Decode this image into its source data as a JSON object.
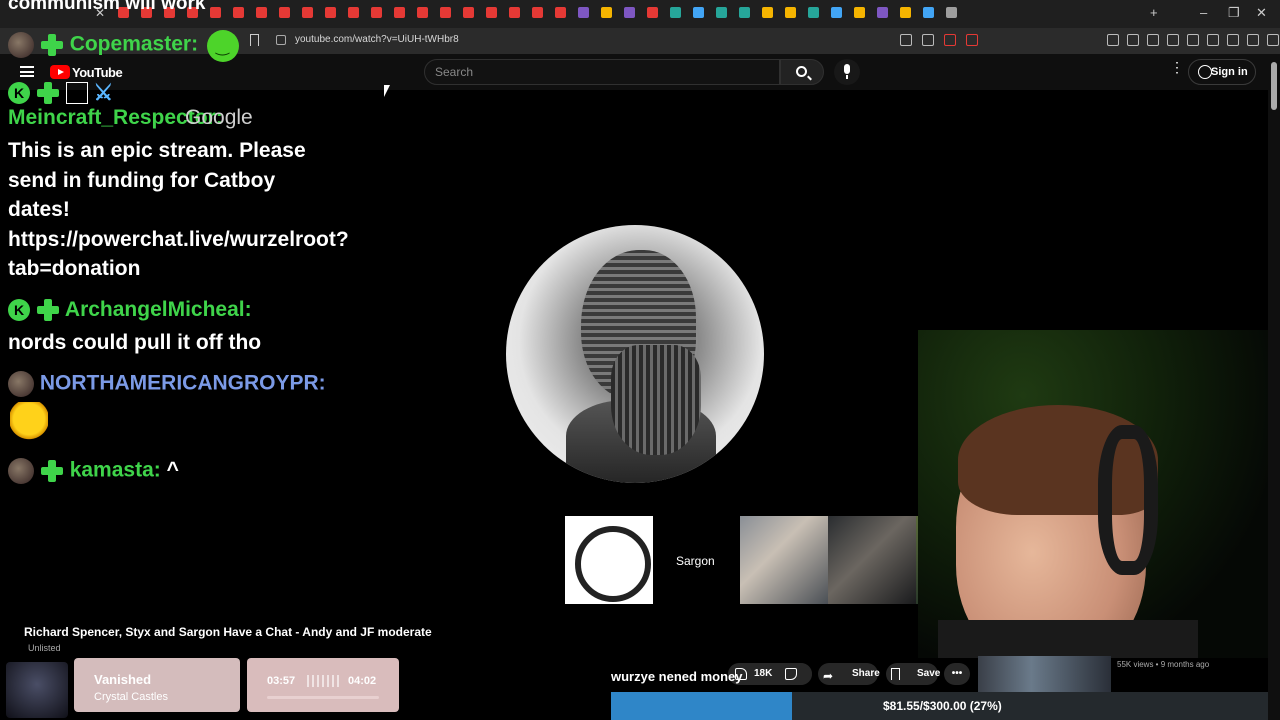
{
  "stream_title": "communism will work",
  "browser": {
    "url": "youtube.com/watch?v=UiUH-tWHbr8"
  },
  "youtube": {
    "logo_text": "YouTube",
    "search_placeholder": "Search",
    "signin_label": "Sign in"
  },
  "chat": {
    "messages": [
      {
        "user": "Copemaster:",
        "text": ""
      },
      {
        "user": "Meincraft_Respector:",
        "text": "This is an epic stream. Please send in funding for Catboy dates! https://powerchat.live/wurzelroot?tab=donation"
      },
      {
        "user": "ArchangelMicheal:",
        "text": "nords could pull it off tho"
      },
      {
        "user": "NORTHAMERICANGROYPR:",
        "text": ""
      },
      {
        "user": "kamasta:",
        "text": "^"
      }
    ],
    "overlay_text": "Google",
    "colors": {
      "username": "#3fd44a",
      "username_alt": "#7b9ae6"
    }
  },
  "video": {
    "participant_label": "Sargon",
    "title": "Richard Spencer, Styx and Sargon Have a Chat - Andy and JF moderate",
    "visibility": "Unlisted",
    "likes": "18K",
    "share_label": "Share",
    "save_label": "Save",
    "views_meta": "55K views • 9 months ago"
  },
  "donation": {
    "message": "wurzye nened money",
    "goal_text": "$81.55/$300.00 (27%)",
    "raised": 81.55,
    "goal": 300.0,
    "progress_fraction": 0.27,
    "colors": {
      "fill": "#2f86c8",
      "track": "#24292d"
    }
  },
  "music": {
    "song": "Vanished",
    "artist": "Crystal Castles",
    "elapsed": "03:57",
    "total": "04:02"
  }
}
